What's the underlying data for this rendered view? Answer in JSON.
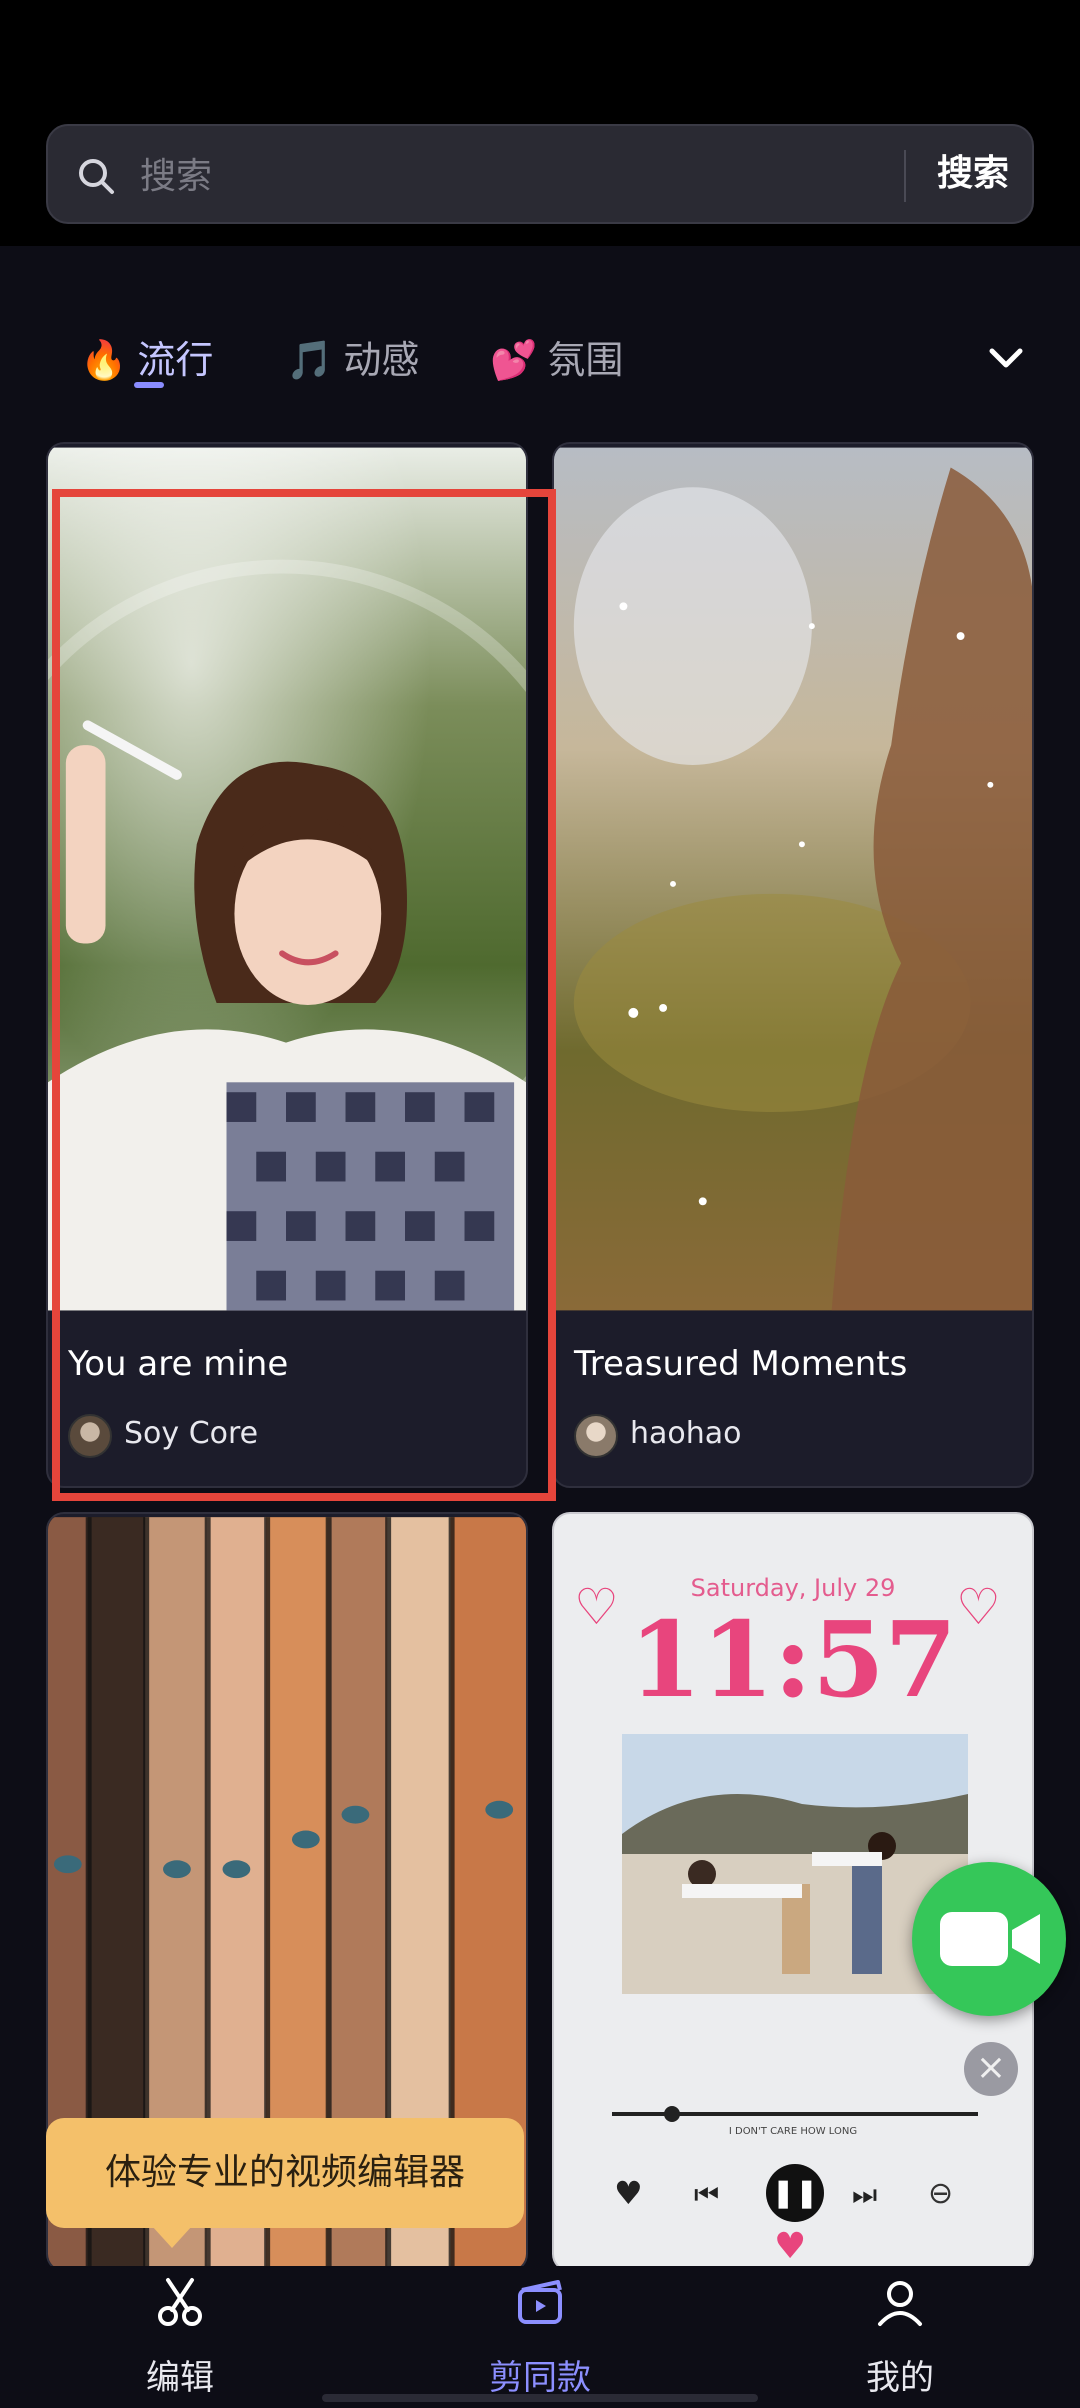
{
  "search": {
    "placeholder": "搜索",
    "button_label": "搜索"
  },
  "tabs": [
    {
      "emoji": "🔥",
      "label": "流行",
      "active": true
    },
    {
      "emoji": "🎵",
      "label": "动感",
      "active": false
    },
    {
      "emoji": "💕",
      "label": "氛围",
      "active": false
    }
  ],
  "cards": [
    {
      "title": "You are mine",
      "author": "Soy Core"
    },
    {
      "title": "Treasured Moments",
      "author": "haohao"
    }
  ],
  "lockscreen": {
    "date": "Saturday, July 29",
    "time": "11:57",
    "song_caption": "I DON'T CARE HOW LONG"
  },
  "tooltip": {
    "text": "体验专业的视频编辑器"
  },
  "bottom_nav": [
    {
      "label": "编辑",
      "icon": "scissors-icon",
      "active": false
    },
    {
      "label": "剪同款",
      "icon": "template-clapper-icon",
      "active": true
    },
    {
      "label": "我的",
      "icon": "profile-icon",
      "active": false
    }
  ],
  "colors": {
    "accent": "#8c8fff",
    "fab_green": "#35c759",
    "tooltip_bg": "#f4c06a",
    "highlight_red": "#e5453b"
  }
}
